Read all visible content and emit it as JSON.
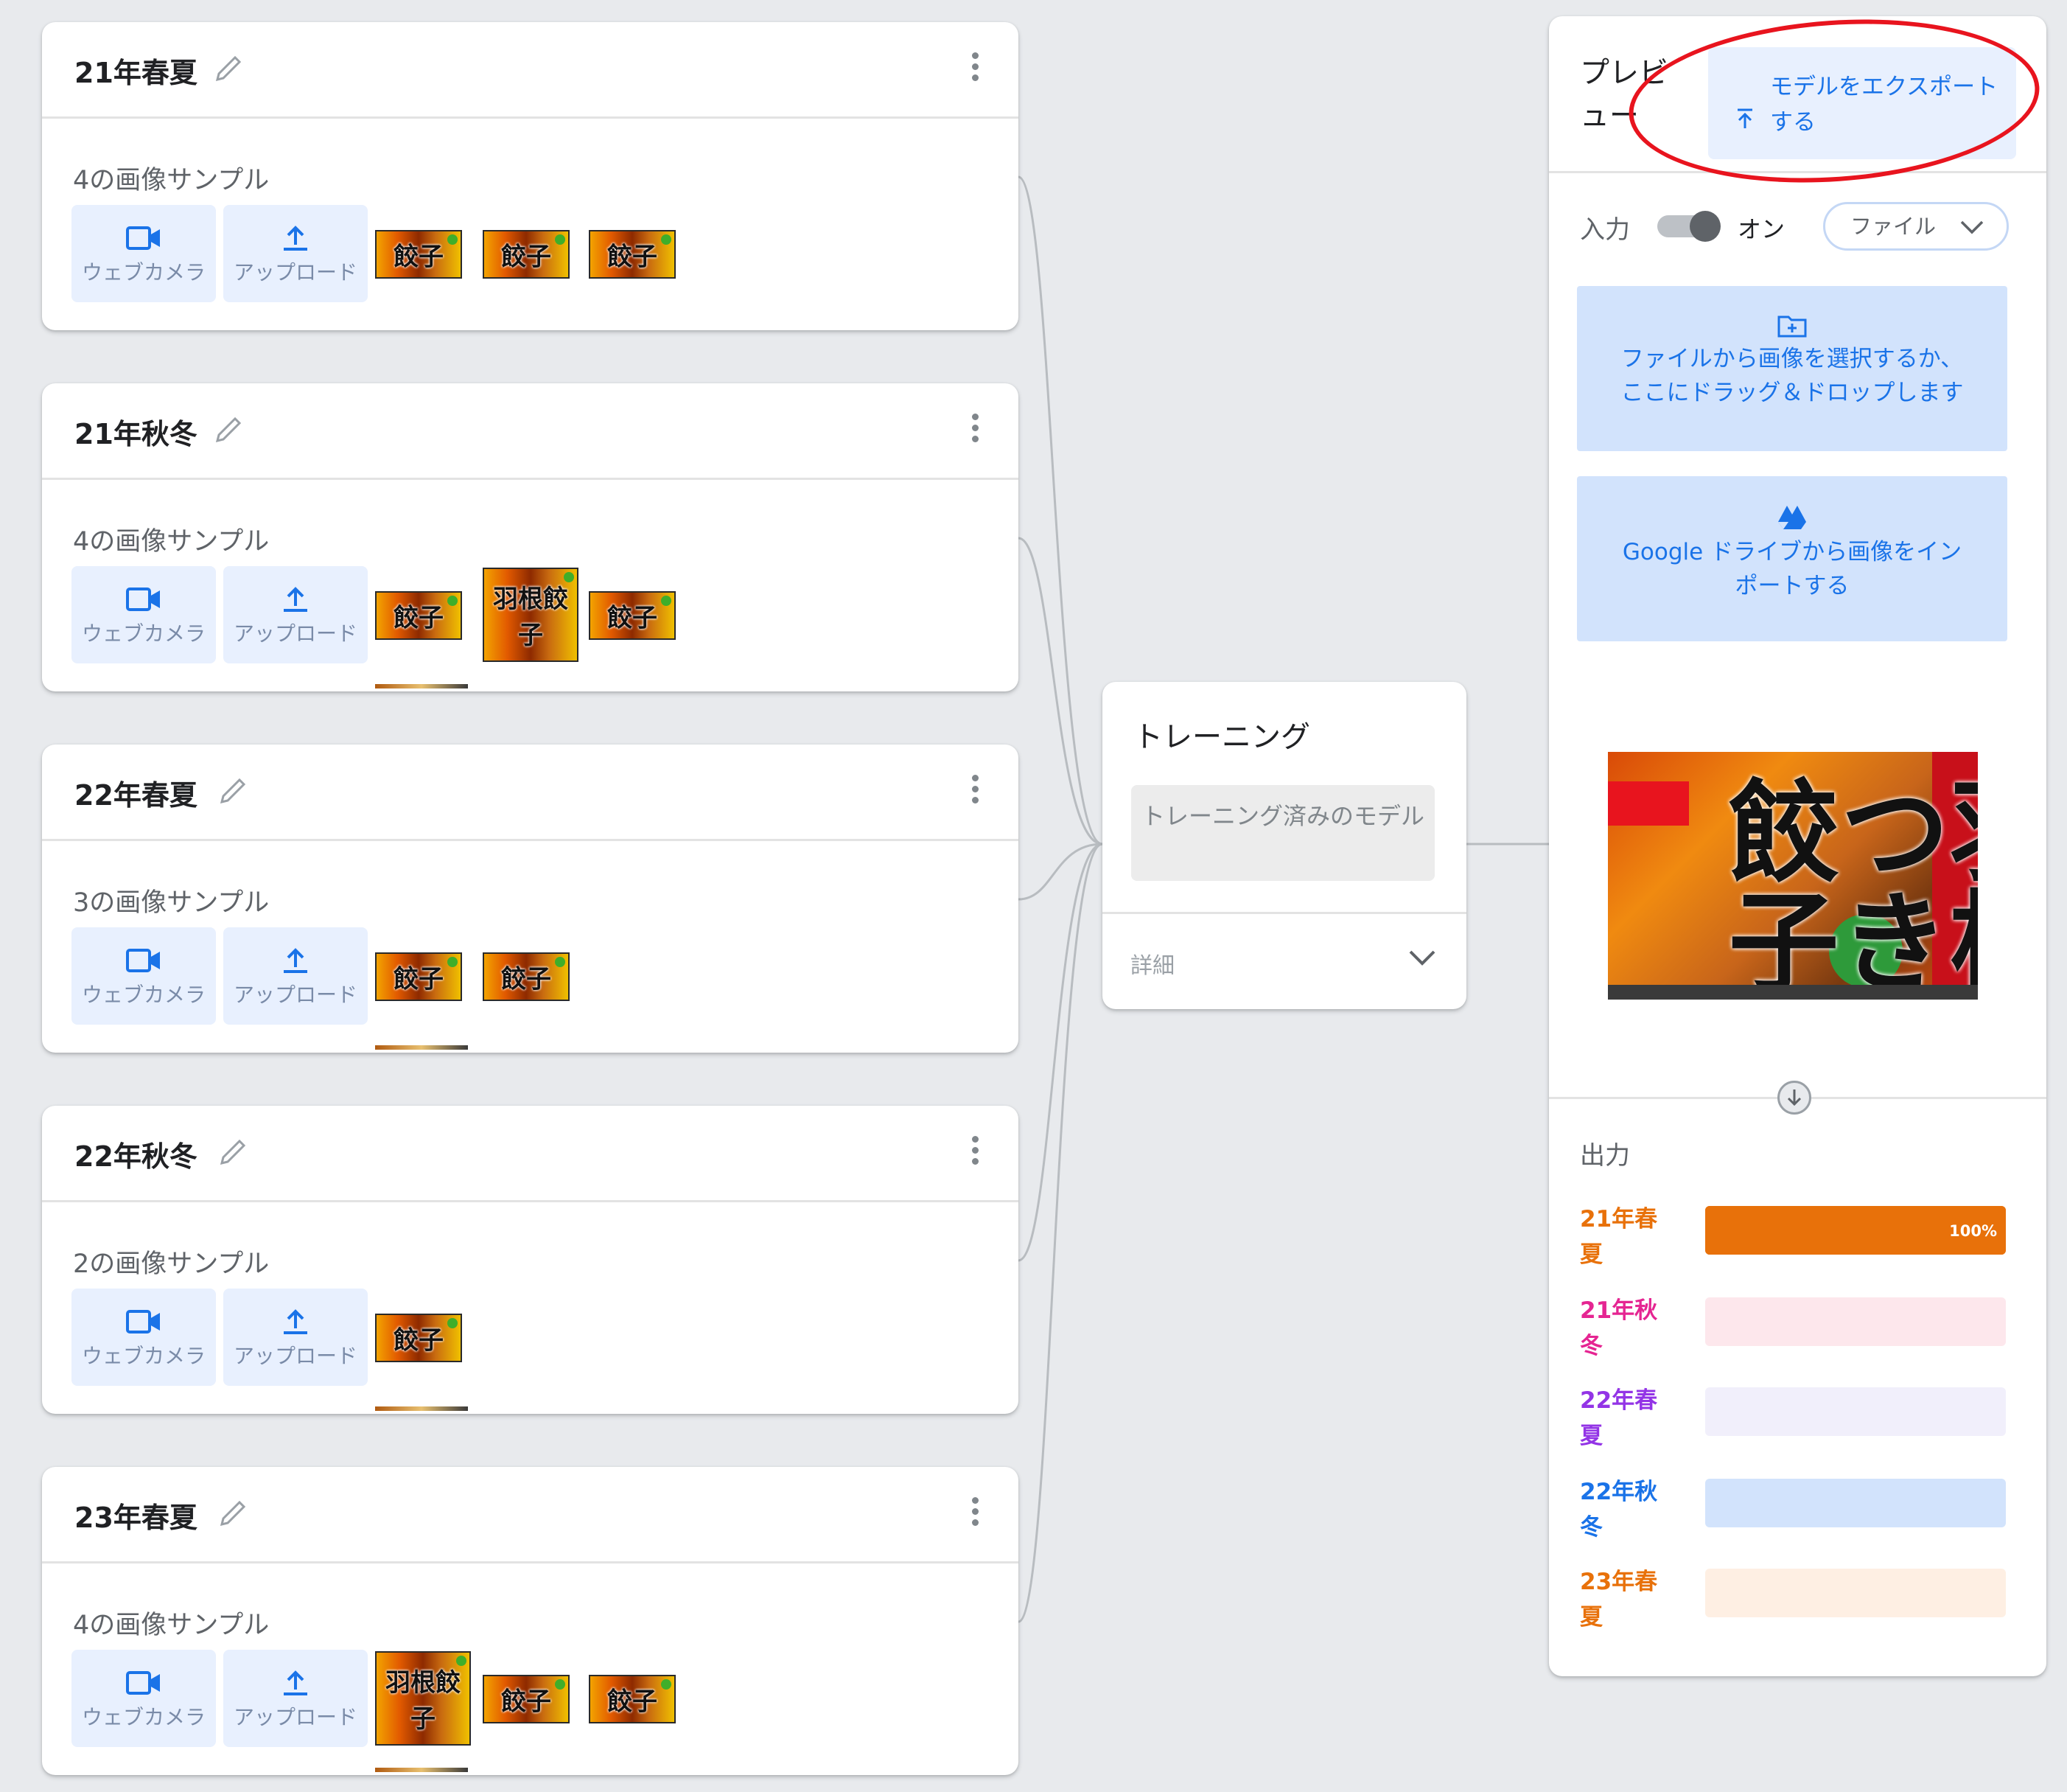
{
  "classes": [
    {
      "title": "21年春夏",
      "sample_count": "4の画像サンプル",
      "thumbs": [
        "餃子",
        "餃子",
        "餃子"
      ],
      "webcam_label": "ウェブカメラ",
      "upload_label": "アップロード"
    },
    {
      "title": "21年秋冬",
      "sample_count": "4の画像サンプル",
      "thumbs": [
        "餃子",
        "羽根餃子",
        "餃子"
      ],
      "webcam_label": "ウェブカメラ",
      "upload_label": "アップロード"
    },
    {
      "title": "22年春夏",
      "sample_count": "3の画像サンプル",
      "thumbs": [
        "餃子",
        "餃子"
      ],
      "webcam_label": "ウェブカメラ",
      "upload_label": "アップロード"
    },
    {
      "title": "22年秋冬",
      "sample_count": "2の画像サンプル",
      "thumbs": [
        "餃子"
      ],
      "webcam_label": "ウェブカメラ",
      "upload_label": "アップロード"
    },
    {
      "title": "23年春夏",
      "sample_count": "4の画像サンプル",
      "thumbs": [
        "羽根餃子",
        "餃子",
        "餃子"
      ],
      "webcam_label": "ウェブカメラ",
      "upload_label": "アップロード"
    }
  ],
  "training": {
    "title": "トレーニング",
    "button_label": "トレーニング済みのモデル",
    "advanced_label": "詳細"
  },
  "preview": {
    "title": "プレビュー",
    "export_label": "モデルをエクスポートする",
    "input_label": "入力",
    "toggle_label": "オン",
    "toggle_on": true,
    "source_select": "ファイル",
    "file_drop_label": "ファイルから画像を選択するか、ここにドラッグ＆ドロップします",
    "drive_label": "Google ドライブから画像をインポートする",
    "image_text": "羽根つき餃子",
    "output_label": "出力",
    "outputs": [
      {
        "name": "21年春夏",
        "value": 1.0,
        "percent_label": "100%",
        "color": "#e8710a",
        "track": "#e8710a"
      },
      {
        "name": "21年秋冬",
        "value": 0.0,
        "percent_label": "",
        "color": "#e52592",
        "track": "#fde7ec"
      },
      {
        "name": "22年春夏",
        "value": 0.0,
        "percent_label": "",
        "color": "#9334e6",
        "track": "#f1effb"
      },
      {
        "name": "22年秋冬",
        "value": 0.0,
        "percent_label": "",
        "color": "#1a73e8",
        "track": "#d2e3fc"
      },
      {
        "name": "23年春夏",
        "value": 0.0,
        "percent_label": "",
        "color": "#e8710a",
        "track": "#feefe3"
      }
    ]
  },
  "icons": {
    "edit": "pencil-icon",
    "more": "more-vert-icon",
    "webcam": "videocam-icon",
    "upload": "upload-icon",
    "export": "upload-arrow-icon",
    "folder": "folder-add-icon",
    "drive": "google-drive-icon",
    "chevron": "chevron-down-icon",
    "arrow": "arrow-down-icon"
  },
  "colors": {
    "accent": "#1a73e8",
    "button_bg": "#e8f0fe",
    "annotation": "#e8141e"
  }
}
